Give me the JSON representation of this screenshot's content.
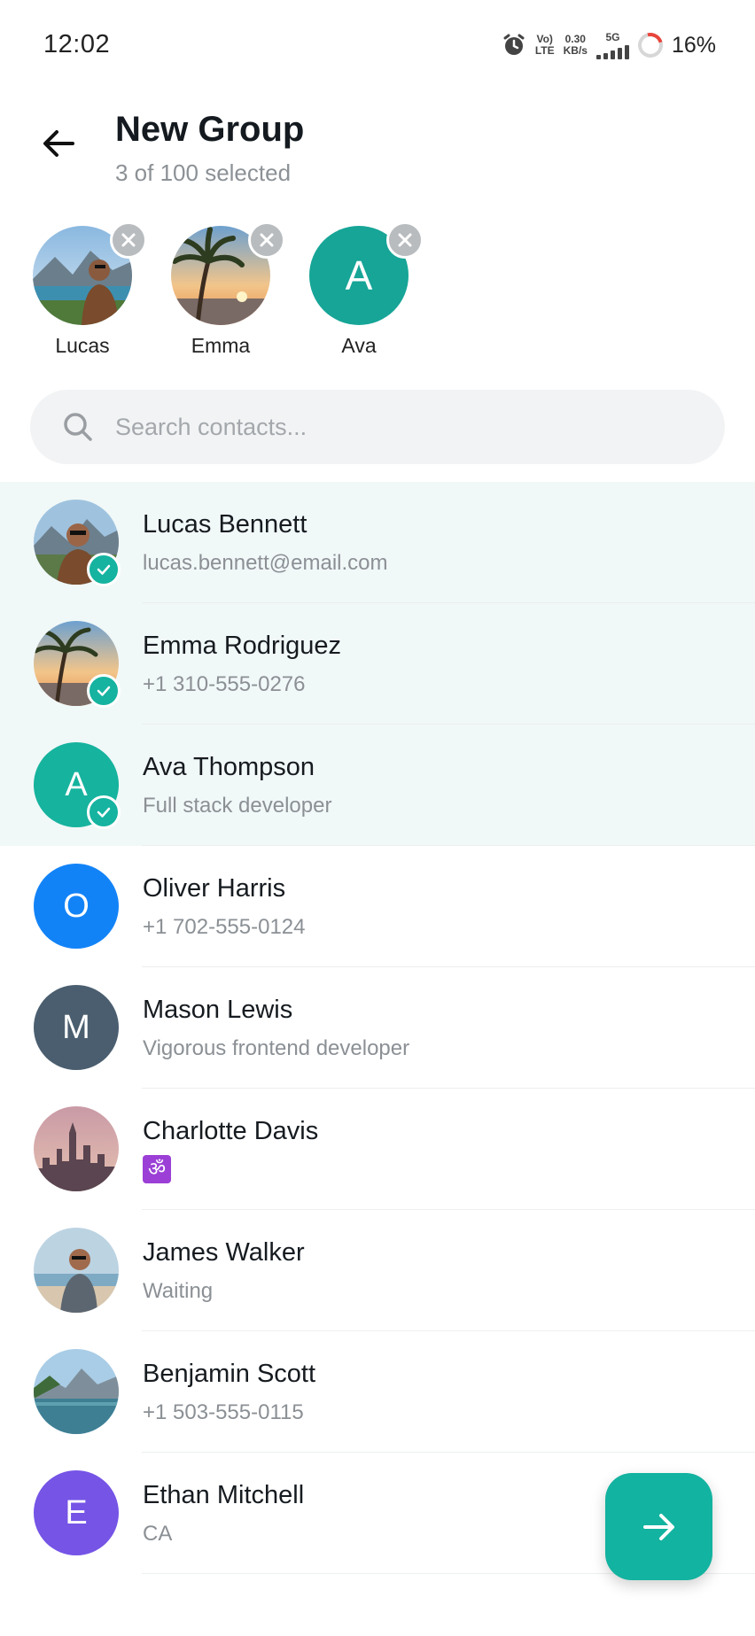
{
  "status_bar": {
    "time": "12:02",
    "volte": "Vo)",
    "lte": "LTE",
    "speed_value": "0.30",
    "speed_unit": "KB/s",
    "network": "5G",
    "battery": "16%"
  },
  "header": {
    "title": "New Group",
    "subtitle": "3 of 100 selected"
  },
  "selected": [
    {
      "name": "Lucas",
      "avatar": "photo-mountain-lake-man"
    },
    {
      "name": "Emma",
      "avatar": "photo-palm-sunset"
    },
    {
      "name": "Ava",
      "initial": "A",
      "color": "#16a597"
    }
  ],
  "search": {
    "placeholder": "Search contacts..."
  },
  "contacts": [
    {
      "name": "Lucas Bennett",
      "detail": "lucas.bennett@email.com",
      "selected": true,
      "avatar": "photo-mountain-lake-man"
    },
    {
      "name": "Emma Rodriguez",
      "detail": "+1 310-555-0276",
      "selected": true,
      "avatar": "photo-palm-sunset"
    },
    {
      "name": "Ava Thompson",
      "detail": "Full stack developer",
      "selected": true,
      "initial": "A",
      "color": "#16b39e"
    },
    {
      "name": "Oliver Harris",
      "detail": "+1 702-555-0124",
      "selected": false,
      "initial": "O",
      "color": "#1283f7"
    },
    {
      "name": "Mason Lewis",
      "detail": "Vigorous frontend developer",
      "selected": false,
      "initial": "M",
      "color": "#4a5e6f"
    },
    {
      "name": "Charlotte Davis",
      "detail": "ॐ",
      "selected": false,
      "avatar": "photo-city-skyline"
    },
    {
      "name": "James Walker",
      "detail": "Waiting",
      "selected": false,
      "avatar": "photo-beach-man"
    },
    {
      "name": "Benjamin Scott",
      "detail": "+1 503-555-0115",
      "selected": false,
      "avatar": "photo-mountain-lake"
    },
    {
      "name": "Ethan Mitchell",
      "detail": "CA",
      "selected": false,
      "initial": "E",
      "color": "#7554e6"
    }
  ],
  "colors": {
    "accent": "#12b3a0",
    "selected_row_bg": "#f1f8f8"
  },
  "icons": {
    "back": "arrow-left-icon",
    "search": "search-icon",
    "remove": "close-icon",
    "check": "check-icon",
    "next": "arrow-right-icon"
  }
}
